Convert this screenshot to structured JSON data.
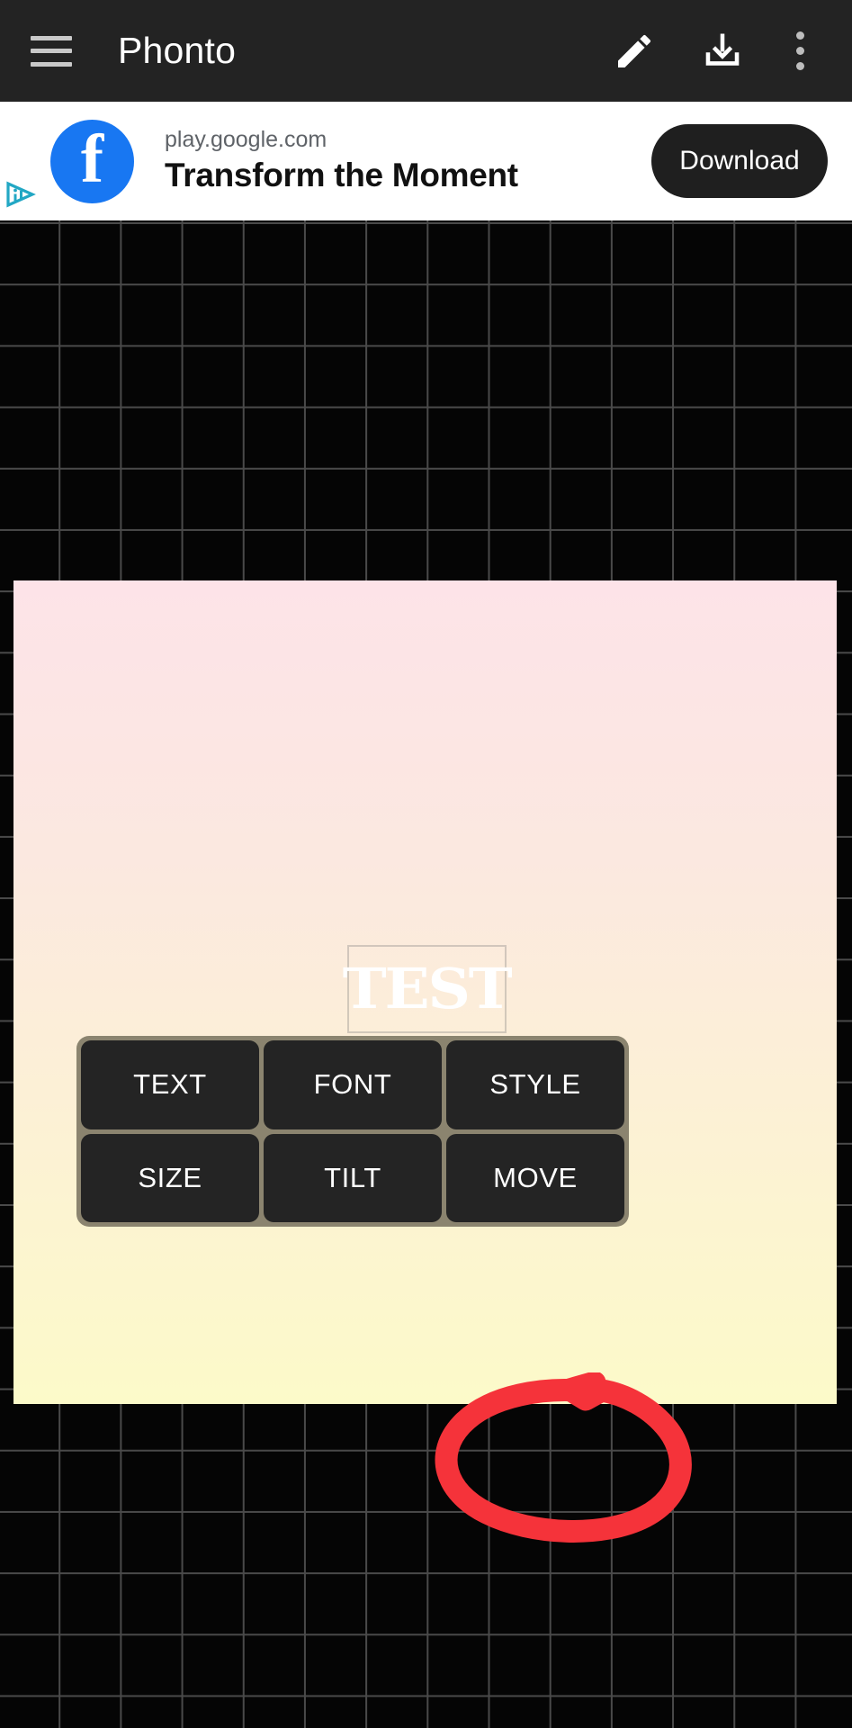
{
  "appbar": {
    "title": "Phonto",
    "menu_icon": "hamburger-menu-icon",
    "edit_icon": "pencil-icon",
    "download_icon": "download-icon",
    "overflow_icon": "three-dot-menu-icon"
  },
  "ad": {
    "adchoices_icon": "adchoices-info-icon",
    "close_label": "✕",
    "advertiser_icon": "facebook-logo-icon",
    "url": "play.google.com",
    "headline": "Transform the Moment",
    "cta_label": "Download"
  },
  "editor": {
    "text_object": {
      "value": "TEST",
      "selected": true
    },
    "tools": [
      {
        "label": "TEXT",
        "name": "text"
      },
      {
        "label": "FONT",
        "name": "font"
      },
      {
        "label": "STYLE",
        "name": "style"
      },
      {
        "label": "SIZE",
        "name": "size"
      },
      {
        "label": "TILT",
        "name": "tilt"
      },
      {
        "label": "MOVE",
        "name": "move"
      }
    ],
    "annotation": {
      "shape": "hand-drawn-ellipse",
      "target": "STYLE",
      "color": "#F5333A"
    }
  },
  "colors": {
    "appbar_bg": "#232323",
    "canvas_top": "#FDE3E8",
    "canvas_bottom": "#FCFAC9",
    "tool_bg": "#242424",
    "tool_frame": "#8B846F",
    "annotation_red": "#F5333A",
    "fb_blue": "#1877F2",
    "adchoices_teal": "#22A7C4"
  }
}
